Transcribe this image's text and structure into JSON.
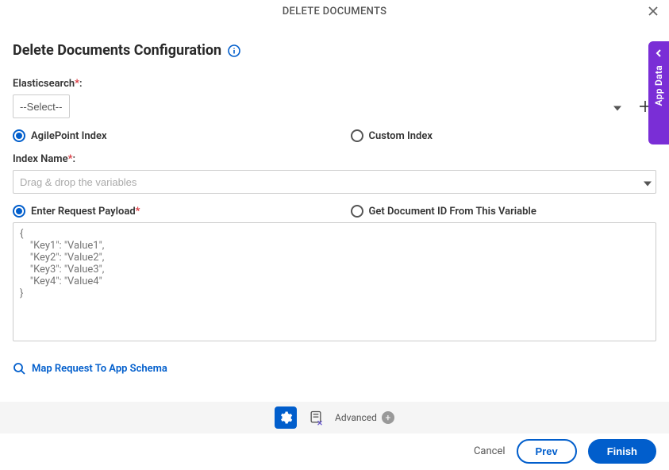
{
  "header": {
    "title": "DELETE DOCUMENTS"
  },
  "page_title": "Delete Documents Configuration",
  "labels": {
    "elasticsearch": "Elasticsearch",
    "index_name": "Index Name",
    "colon": ":",
    "asterisk": "*"
  },
  "elasticsearch_select": {
    "value": "--Select--"
  },
  "index_type": {
    "agilepoint": "AgilePoint Index",
    "custom": "Custom Index"
  },
  "index_name_input": {
    "placeholder": "Drag & drop the variables"
  },
  "payload_choice": {
    "enter": "Enter Request Payload",
    "get_from_var": "Get Document ID From This Variable"
  },
  "payload_placeholder": "{\n    \"Key1\": \"Value1\",\n    \"Key2\": \"Value2\",\n    \"Key3\": \"Value3\",\n    \"Key4\": \"Value4\"\n}",
  "map_link": "Map Request To App Schema",
  "toolbar": {
    "advanced": "Advanced"
  },
  "footer": {
    "cancel": "Cancel",
    "prev": "Prev",
    "finish": "Finish"
  },
  "side_tab": "App Data"
}
